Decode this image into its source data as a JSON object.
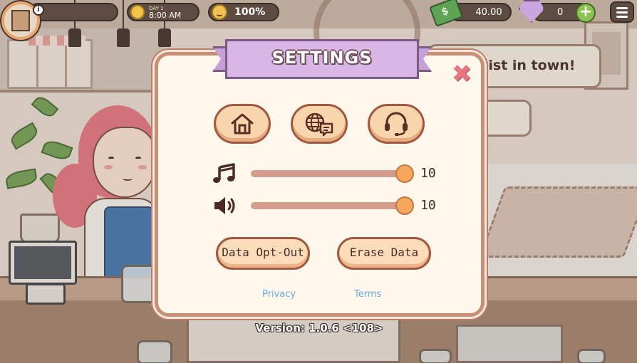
{
  "hud": {
    "day_label": "DAY 1",
    "time": "8:00 AM",
    "happiness": "100%",
    "cash": "40.00",
    "gems": "0",
    "info_glyph": "i",
    "plus_glyph": "+"
  },
  "background": {
    "speech_text": "vist in town!"
  },
  "settings": {
    "title": "SETTINGS",
    "close_glyph": "✖",
    "icon_buttons": [
      "home-icon",
      "language-globe-icon",
      "support-headset-icon"
    ],
    "music": {
      "icon": "music-note-icon",
      "value": "10",
      "level": 1.0
    },
    "sound": {
      "icon": "speaker-icon",
      "value": "10",
      "level": 1.0
    },
    "data_opt_out_label": "Data Opt-Out",
    "erase_data_label": "Erase Data",
    "privacy_label": "Privacy",
    "terms_label": "Terms",
    "version": "Version: 1.0.6 <108>"
  },
  "colors": {
    "dialog_bg": "#fdf7ec",
    "dialog_border": "#c88f78",
    "ribbon": "#d8b7e6",
    "button_fill": "#f9d5ad",
    "slider_knob": "#f5a85c",
    "slider_track": "#d49c8d",
    "close": "#e9757f",
    "link": "#6aa9e6"
  }
}
